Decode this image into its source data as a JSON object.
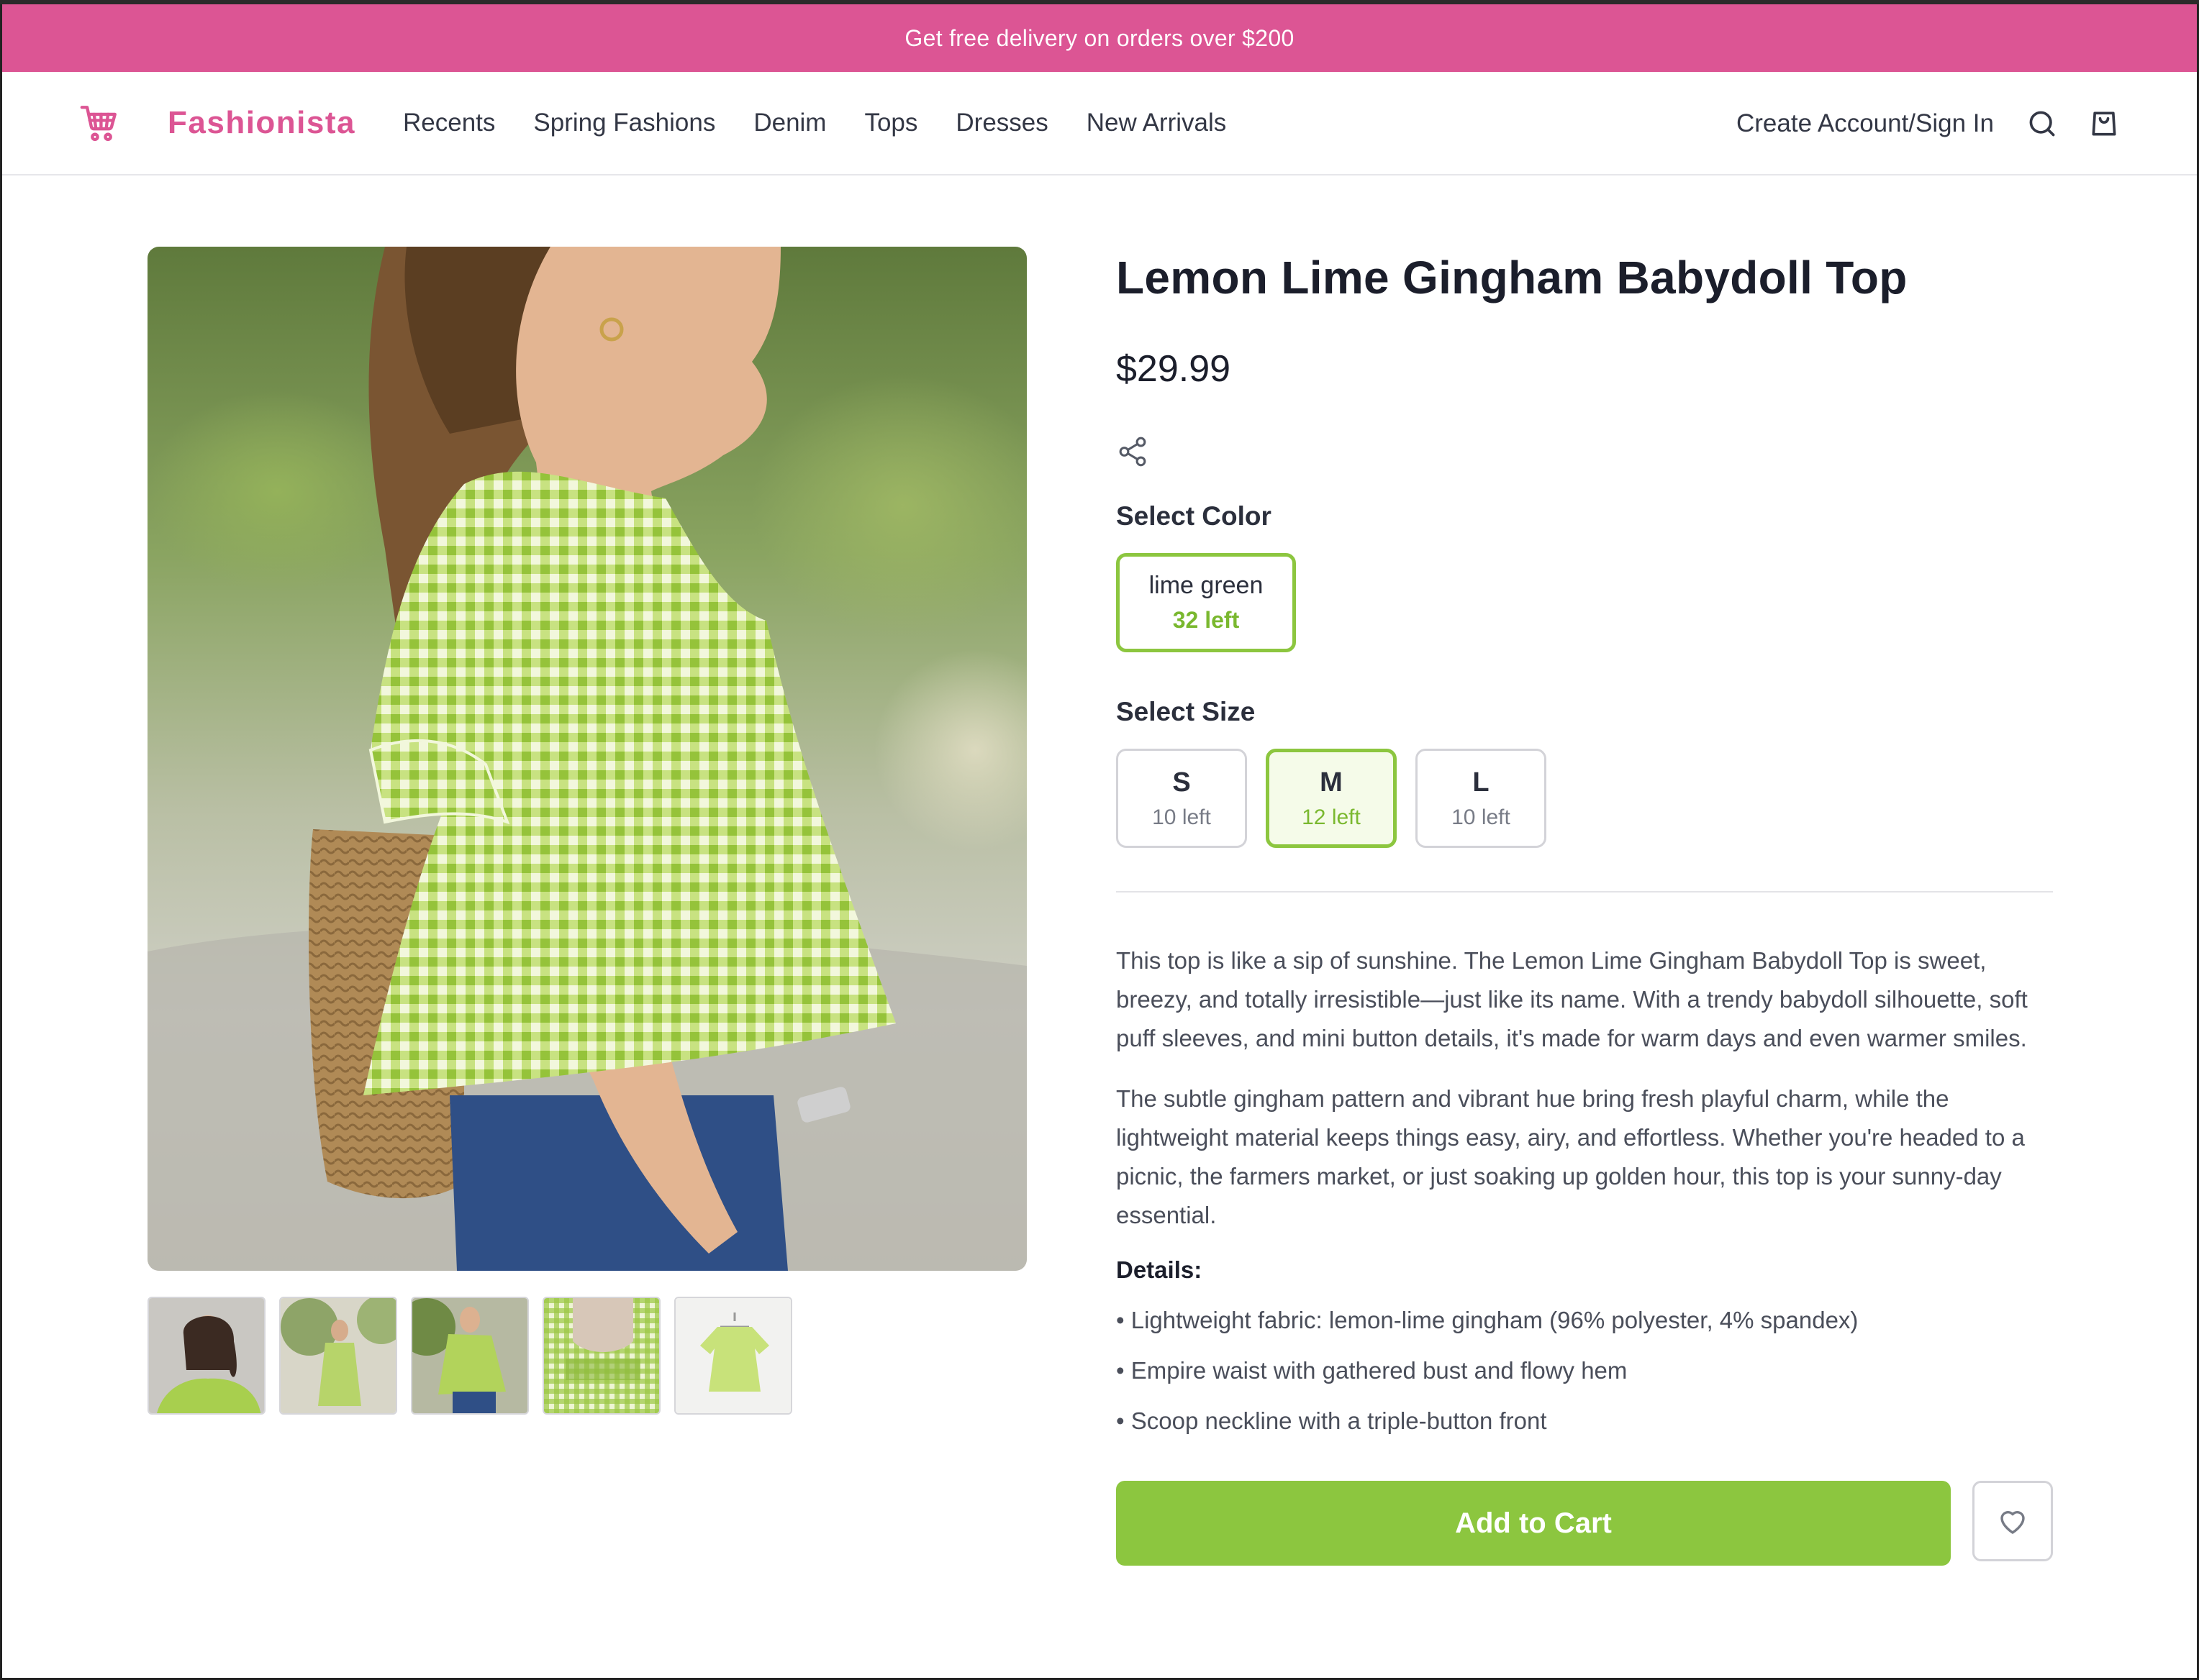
{
  "promo": {
    "text": "Get free delivery on orders over $200"
  },
  "brand": {
    "name": "Fashionista",
    "icon": "shopping-cart-icon",
    "color": "#dc5594"
  },
  "nav": {
    "links": [
      "Recents",
      "Spring Fashions",
      "Denim",
      "Tops",
      "Dresses",
      "New Arrivals"
    ],
    "account_label": "Create Account/Sign In",
    "icons": [
      "search-icon",
      "shopping-bag-icon"
    ]
  },
  "product": {
    "title": "Lemon Lime Gingham Babydoll Top",
    "price": "$29.99",
    "share_icon": "share-icon",
    "color_label": "Select Color",
    "colors": [
      {
        "name": "lime green",
        "stock": "32 left",
        "selected": true
      }
    ],
    "size_label": "Select Size",
    "sizes": [
      {
        "name": "S",
        "stock": "10 left",
        "selected": false
      },
      {
        "name": "M",
        "stock": "12 left",
        "selected": true
      },
      {
        "name": "L",
        "stock": "10 left",
        "selected": false
      }
    ],
    "description": [
      "This top is like a sip of sunshine. The Lemon Lime Gingham Babydoll Top is sweet, breezy, and totally irresistible—just like its name. With a trendy babydoll silhouette, soft puff sleeves, and mini button details, it's made for warm days and even warmer smiles.",
      "The subtle gingham pattern and vibrant hue bring fresh playful charm, while the lightweight material keeps things easy, airy, and effortless. Whether you're headed to a picnic, the farmers market, or just soaking up golden hour, this top is your sunny-day essential."
    ],
    "details_label": "Details:",
    "details": [
      "• Lightweight fabric: lemon-lime gingham (96% polyester, 4% spandex)",
      "• Empire waist with gathered bust and flowy hem",
      "• Scoop neckline with a triple-button front"
    ],
    "add_to_cart": "Add to Cart",
    "wishlist_icon": "heart-icon",
    "accent_color": "#8cc63f"
  },
  "gallery": {
    "thumbnail_count": 5,
    "selected_thumbnail": 3
  }
}
